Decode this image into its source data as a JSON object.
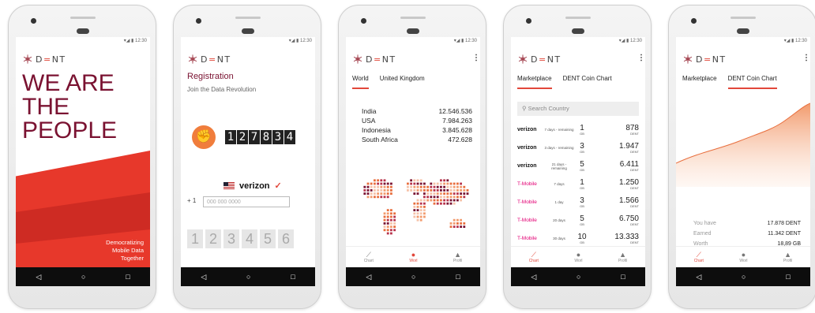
{
  "status_time": "12:30",
  "brand": {
    "prefix": "D",
    "highlight": "=",
    "suffix": "NT",
    "accent": "#e2473a",
    "dark": "#7a1231"
  },
  "screen1": {
    "hero_lines": [
      "WE ARE",
      "THE",
      "PEOPLE"
    ],
    "tagline_lines": [
      "Democratizing",
      "Mobile Data",
      "Together"
    ]
  },
  "screen2": {
    "title": "Registration",
    "subtitle": "Join the Data Revolution",
    "counter_digits": [
      "1",
      "2",
      "7",
      "8",
      "3",
      "4"
    ],
    "operator": "verizon",
    "country_code": "+ 1",
    "phone_placeholder": "000 000 0000",
    "code_digits": [
      "1",
      "2",
      "3",
      "4",
      "5",
      "6"
    ]
  },
  "screen3": {
    "tabs": [
      "World",
      "United Kingdom"
    ],
    "stats": [
      {
        "country": "India",
        "value": "12.546.536"
      },
      {
        "country": "USA",
        "value": "7.984.263"
      },
      {
        "country": "Indonesia",
        "value": "3.845.628"
      },
      {
        "country": "South Africa",
        "value": "472.628"
      }
    ],
    "bottom_nav": [
      "Chart",
      "Worl",
      "Profil"
    ]
  },
  "screen4": {
    "tabs": [
      "Marketplace",
      "DENT Coin Chart"
    ],
    "search_placeholder": "Search Country",
    "unit_gb": "GB",
    "unit_dent": "DENT",
    "offers": [
      {
        "operator": "verizon",
        "days": "7 days - remaining",
        "gb": "1",
        "price": "878"
      },
      {
        "operator": "verizon",
        "days": "3 days - remaining",
        "gb": "3",
        "price": "1.947"
      },
      {
        "operator": "verizon",
        "days": "21 days - remaining",
        "gb": "5",
        "price": "6.411"
      },
      {
        "operator": "T-Mobile",
        "days": "7 days",
        "gb": "1",
        "price": "1.250"
      },
      {
        "operator": "T-Mobile",
        "days": "1 day",
        "gb": "3",
        "price": "1.566"
      },
      {
        "operator": "T-Mobile",
        "days": "20 days",
        "gb": "5",
        "price": "6.750"
      },
      {
        "operator": "T-Mobile",
        "days": "30 days",
        "gb": "10",
        "price": "13.333"
      }
    ],
    "bottom_nav": [
      "Chart",
      "Worl",
      "Profil"
    ]
  },
  "screen5": {
    "tabs": [
      "Marketplace",
      "DENT Coin Chart"
    ],
    "balances": [
      {
        "label": "You have",
        "value": "17.878 DENT"
      },
      {
        "label": "Earned",
        "value": "11.342 DENT"
      },
      {
        "label": "Worth",
        "value": "18,89 GB"
      }
    ],
    "bottom_nav": [
      "Chart",
      "Worl",
      "Profil"
    ]
  },
  "navbar_icons": [
    "back-icon",
    "home-icon",
    "recents-icon"
  ]
}
